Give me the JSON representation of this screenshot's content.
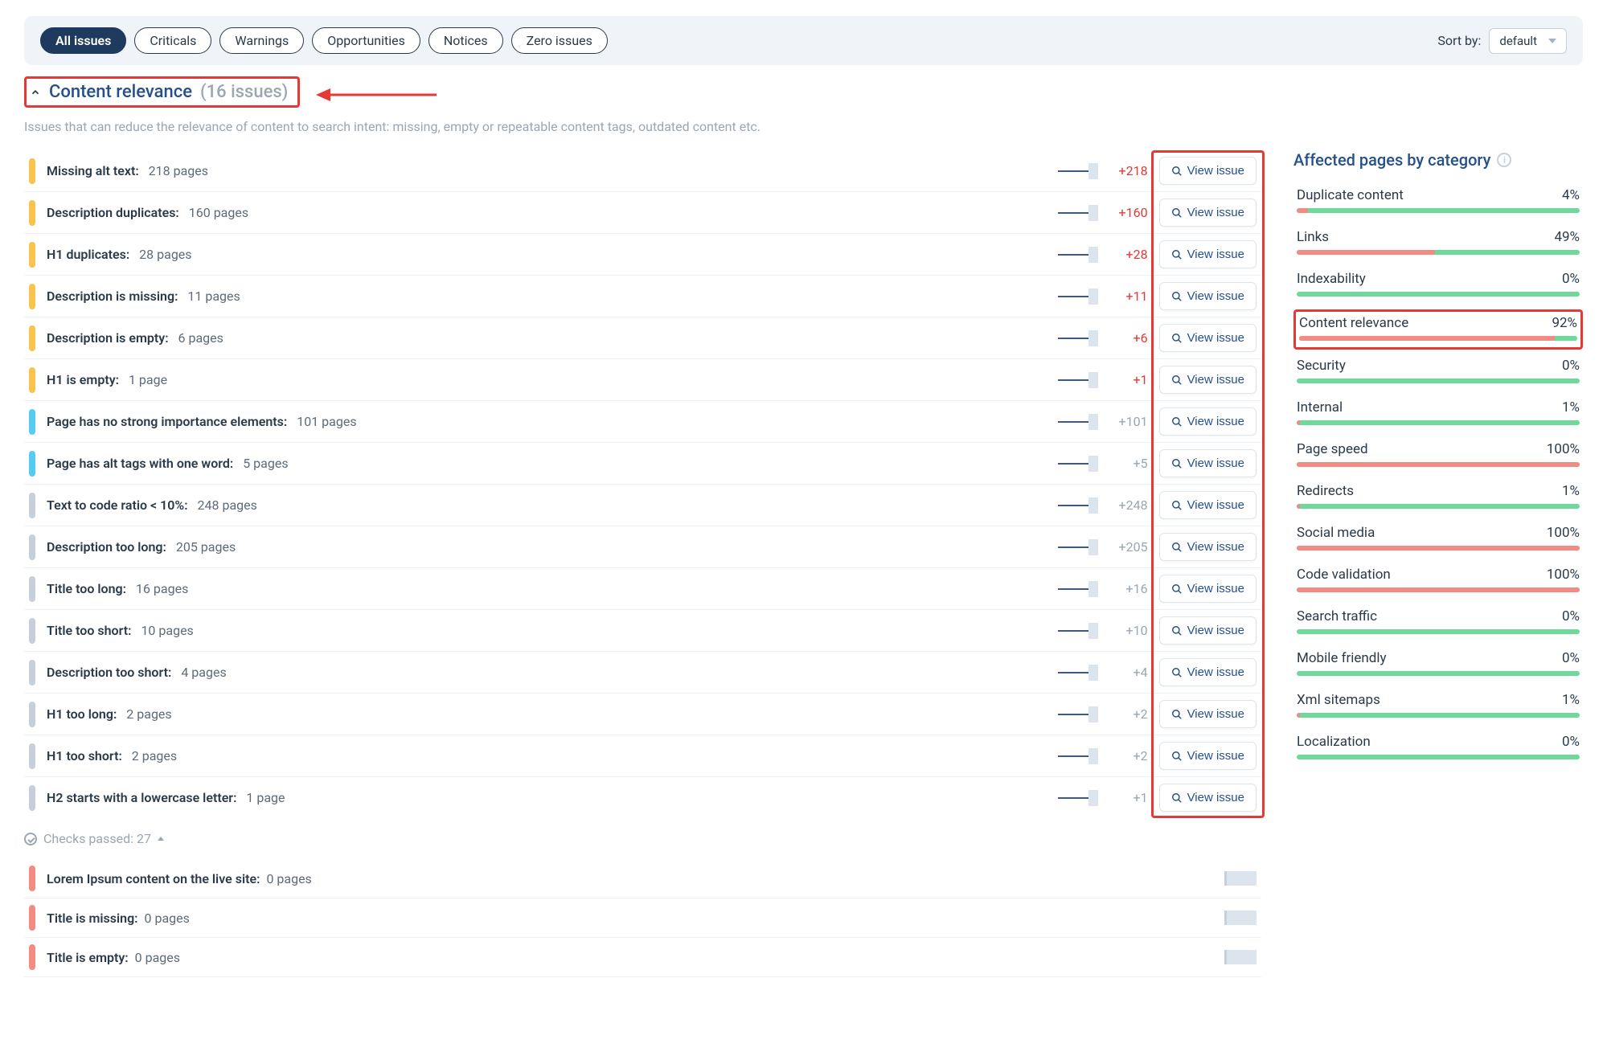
{
  "filters": {
    "pills": [
      "All issues",
      "Criticals",
      "Warnings",
      "Opportunities",
      "Notices",
      "Zero issues"
    ],
    "active_index": 0,
    "sort_label": "Sort by:",
    "sort_value": "default"
  },
  "section": {
    "title": "Content relevance",
    "count_label": "(16 issues)",
    "description": "Issues that can reduce the relevance of content to search intent: missing, empty or repeatable content tags, outdated content etc."
  },
  "view_issue_label": "View issue",
  "issues": [
    {
      "severity": "warning",
      "name": "Missing alt text:",
      "pages": "218 pages",
      "delta": "+218",
      "delta_type": "pos"
    },
    {
      "severity": "warning",
      "name": "Description duplicates:",
      "pages": "160 pages",
      "delta": "+160",
      "delta_type": "pos"
    },
    {
      "severity": "warning",
      "name": "H1 duplicates:",
      "pages": "28 pages",
      "delta": "+28",
      "delta_type": "pos"
    },
    {
      "severity": "warning",
      "name": "Description is missing:",
      "pages": "11 pages",
      "delta": "+11",
      "delta_type": "pos"
    },
    {
      "severity": "warning",
      "name": "Description is empty:",
      "pages": "6 pages",
      "delta": "+6",
      "delta_type": "pos"
    },
    {
      "severity": "warning",
      "name": "H1 is empty:",
      "pages": "1 page",
      "delta": "+1",
      "delta_type": "pos"
    },
    {
      "severity": "info",
      "name": "Page has no strong importance elements:",
      "pages": "101 pages",
      "delta": "+101",
      "delta_type": "neutral"
    },
    {
      "severity": "info",
      "name": "Page has alt tags with one word:",
      "pages": "5 pages",
      "delta": "+5",
      "delta_type": "neutral"
    },
    {
      "severity": "notice",
      "name": "Text to code ratio < 10%:",
      "pages": "248 pages",
      "delta": "+248",
      "delta_type": "neutral"
    },
    {
      "severity": "notice",
      "name": "Description too long:",
      "pages": "205 pages",
      "delta": "+205",
      "delta_type": "neutral"
    },
    {
      "severity": "notice",
      "name": "Title too long:",
      "pages": "16 pages",
      "delta": "+16",
      "delta_type": "neutral"
    },
    {
      "severity": "notice",
      "name": "Title too short:",
      "pages": "10 pages",
      "delta": "+10",
      "delta_type": "neutral"
    },
    {
      "severity": "notice",
      "name": "Description too short:",
      "pages": "4 pages",
      "delta": "+4",
      "delta_type": "neutral"
    },
    {
      "severity": "notice",
      "name": "H1 too long:",
      "pages": "2 pages",
      "delta": "+2",
      "delta_type": "neutral"
    },
    {
      "severity": "notice",
      "name": "H1 too short:",
      "pages": "2 pages",
      "delta": "+2",
      "delta_type": "neutral"
    },
    {
      "severity": "notice",
      "name": "H2 starts with a lowercase letter:",
      "pages": "1 page",
      "delta": "+1",
      "delta_type": "neutral"
    }
  ],
  "checks_passed_label": "Checks passed: 27",
  "passed": [
    {
      "severity": "critical",
      "name": "Lorem Ipsum content on the live site:",
      "pages": "0 pages"
    },
    {
      "severity": "critical",
      "name": "Title is missing:",
      "pages": "0 pages"
    },
    {
      "severity": "critical",
      "name": "Title is empty:",
      "pages": "0 pages"
    }
  ],
  "sidebar": {
    "title": "Affected pages by category",
    "categories": [
      {
        "name": "Duplicate content",
        "pct": "4%",
        "red": 4
      },
      {
        "name": "Links",
        "pct": "49%",
        "red": 49
      },
      {
        "name": "Indexability",
        "pct": "0%",
        "red": 0
      },
      {
        "name": "Content relevance",
        "pct": "92%",
        "red": 92,
        "highlighted": true
      },
      {
        "name": "Security",
        "pct": "0%",
        "red": 0
      },
      {
        "name": "Internal",
        "pct": "1%",
        "red": 1
      },
      {
        "name": "Page speed",
        "pct": "100%",
        "red": 100
      },
      {
        "name": "Redirects",
        "pct": "1%",
        "red": 1
      },
      {
        "name": "Social media",
        "pct": "100%",
        "red": 100
      },
      {
        "name": "Code validation",
        "pct": "100%",
        "red": 100
      },
      {
        "name": "Search traffic",
        "pct": "0%",
        "red": 0
      },
      {
        "name": "Mobile friendly",
        "pct": "0%",
        "red": 0
      },
      {
        "name": "Xml sitemaps",
        "pct": "1%",
        "red": 1
      },
      {
        "name": "Localization",
        "pct": "0%",
        "red": 0
      }
    ]
  }
}
